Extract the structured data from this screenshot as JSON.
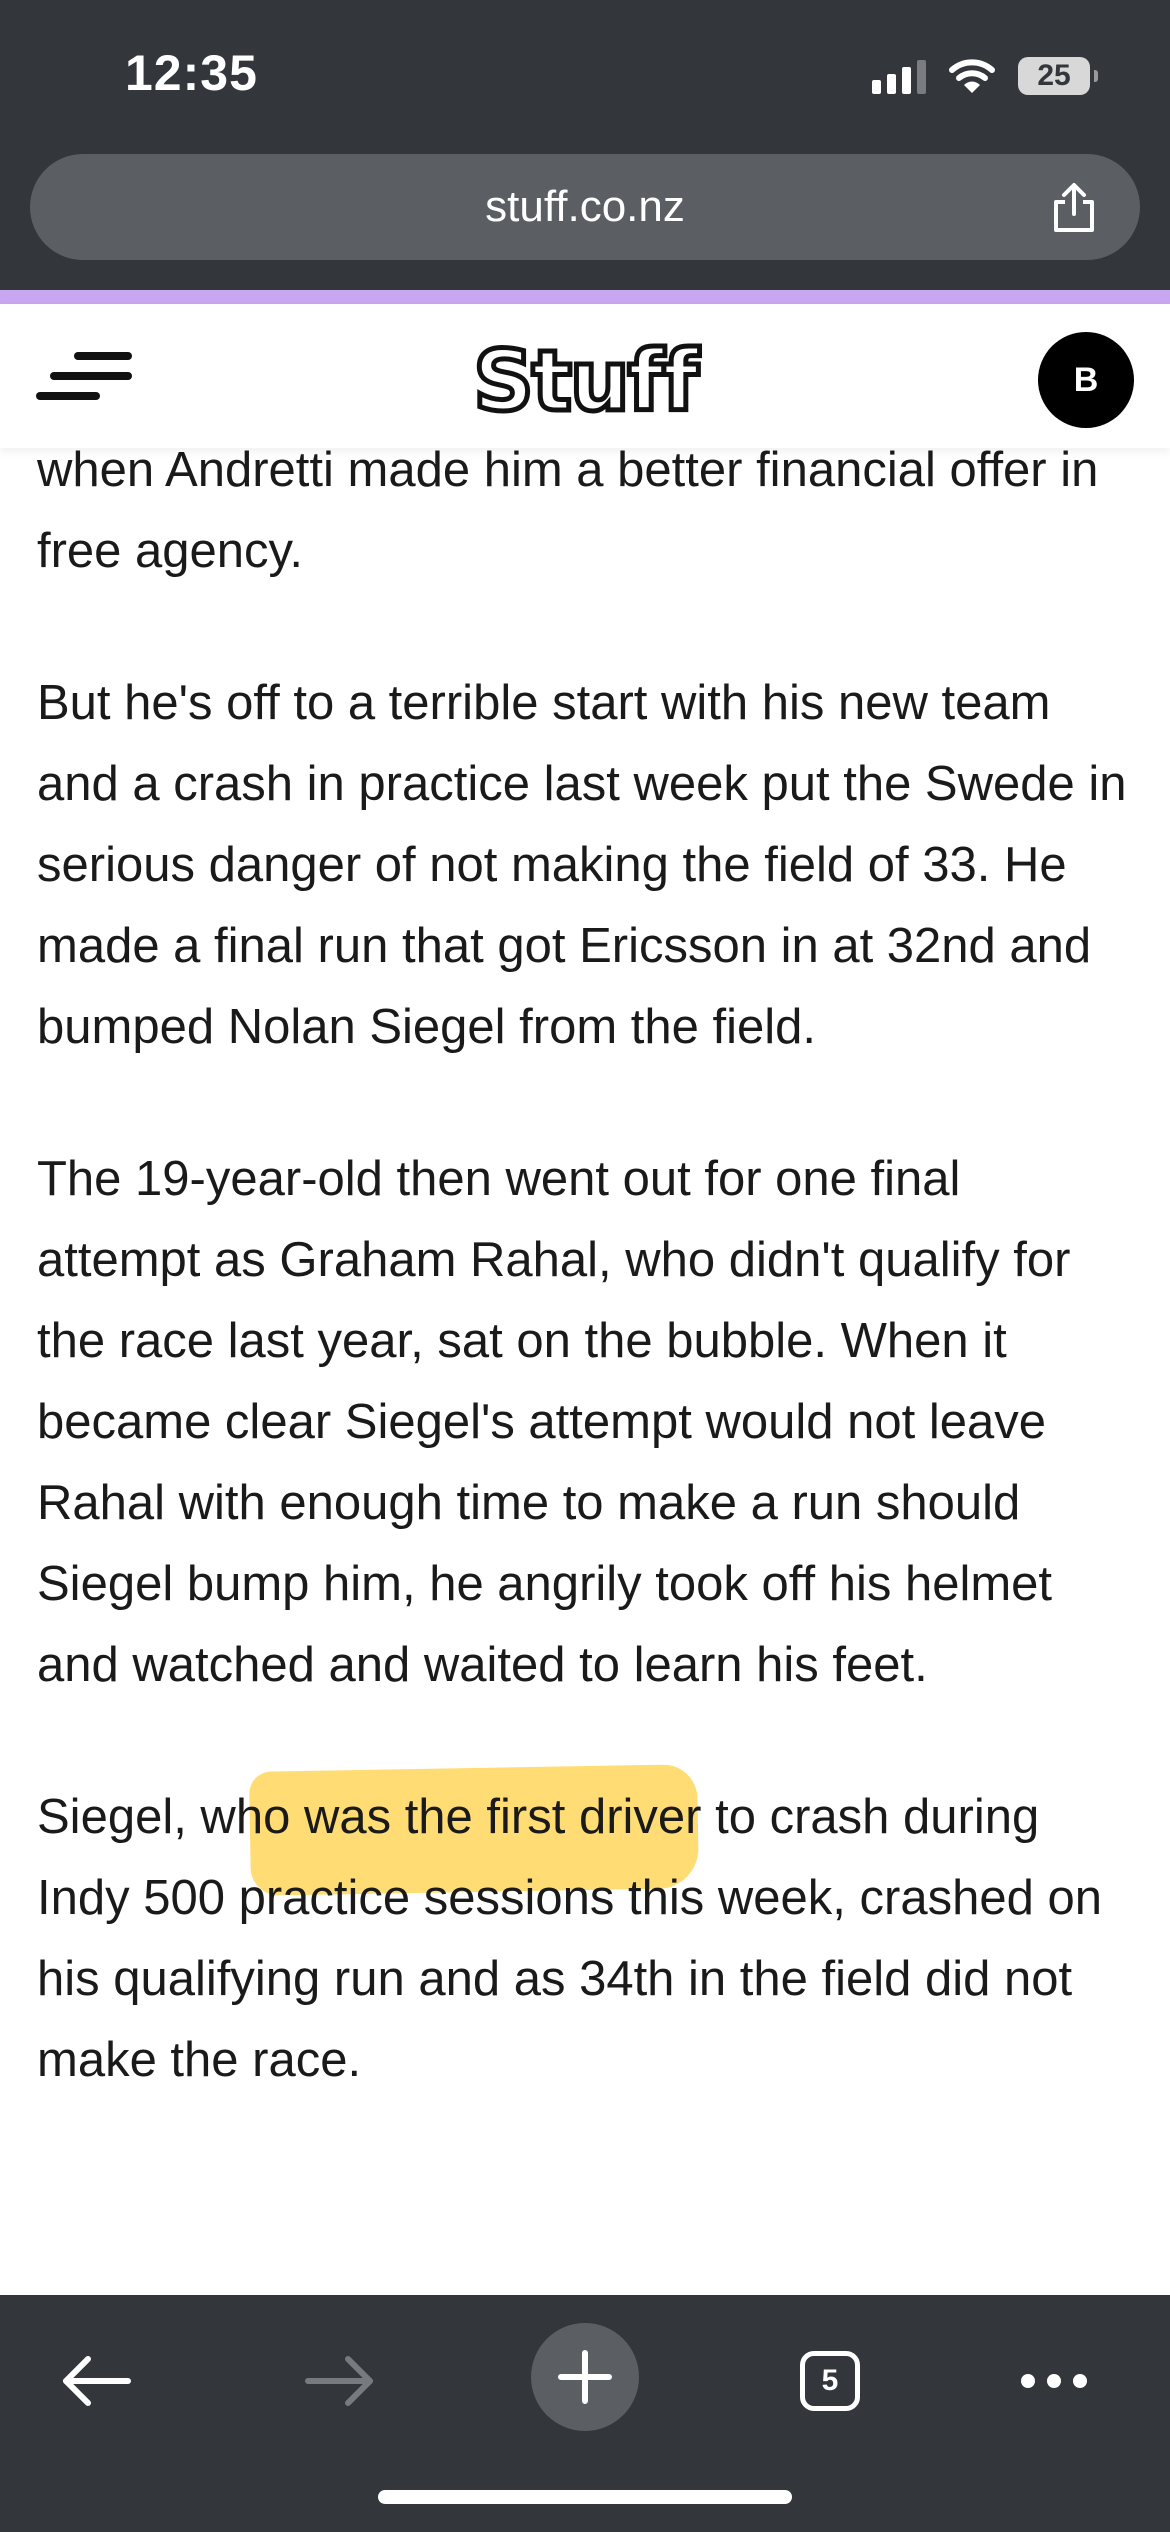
{
  "status_bar": {
    "time": "12:35",
    "battery": "25",
    "icons": [
      "signal-icon",
      "wifi-icon",
      "battery-icon"
    ]
  },
  "browser": {
    "url": "stuff.co.nz",
    "share_icon": "share-icon",
    "accent_color": "#c9a6f2",
    "tab_count": "5",
    "toolbar_icons": [
      "back-arrow-icon",
      "forward-arrow-icon",
      "plus-icon",
      "tabs-icon",
      "more-icon"
    ]
  },
  "site": {
    "logo": "Stuff",
    "avatar_initial": "B",
    "menu_icon": "hamburger-menu-icon"
  },
  "article": {
    "p1": "when Andretti made him a better financial offer in free agency.",
    "p2": "But he's off to a terrible start with his new team and a crash in practice last week put the Swede in serious danger of not making the field of 33. He made a final run that got Ericsson in at 32nd and bumped Nolan Siegel from the field.",
    "p3_before": "The 19-year-old then went out for one final attempt as Graham Rahal, who didn't qualify for the race last year, sat on the bubble. When it became clear Siegel's attempt would not leave Rahal with enough time to make a run should Siegel bump him, he angrily took off his helmet and watched and waited to ",
    "p3_highlight": "learn his feet.",
    "p4": "Siegel, who was the first driver to crash during Indy 500 practice sessions this week, crashed on his qualifying run and as 34th in the field did not make the race.",
    "highlight_color": "#ffd34d"
  }
}
